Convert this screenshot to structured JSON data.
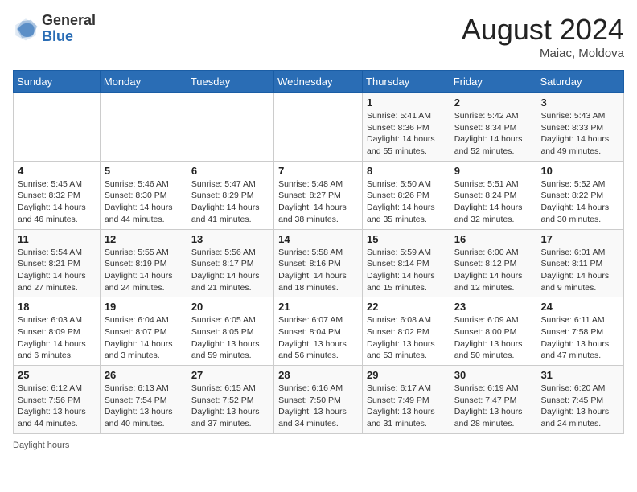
{
  "header": {
    "logo_general": "General",
    "logo_blue": "Blue",
    "month_title": "August 2024",
    "location": "Maiac, Moldova"
  },
  "days_of_week": [
    "Sunday",
    "Monday",
    "Tuesday",
    "Wednesday",
    "Thursday",
    "Friday",
    "Saturday"
  ],
  "weeks": [
    [
      {
        "day": "",
        "info": ""
      },
      {
        "day": "",
        "info": ""
      },
      {
        "day": "",
        "info": ""
      },
      {
        "day": "",
        "info": ""
      },
      {
        "day": "1",
        "info": "Sunrise: 5:41 AM\nSunset: 8:36 PM\nDaylight: 14 hours and 55 minutes."
      },
      {
        "day": "2",
        "info": "Sunrise: 5:42 AM\nSunset: 8:34 PM\nDaylight: 14 hours and 52 minutes."
      },
      {
        "day": "3",
        "info": "Sunrise: 5:43 AM\nSunset: 8:33 PM\nDaylight: 14 hours and 49 minutes."
      }
    ],
    [
      {
        "day": "4",
        "info": "Sunrise: 5:45 AM\nSunset: 8:32 PM\nDaylight: 14 hours and 46 minutes."
      },
      {
        "day": "5",
        "info": "Sunrise: 5:46 AM\nSunset: 8:30 PM\nDaylight: 14 hours and 44 minutes."
      },
      {
        "day": "6",
        "info": "Sunrise: 5:47 AM\nSunset: 8:29 PM\nDaylight: 14 hours and 41 minutes."
      },
      {
        "day": "7",
        "info": "Sunrise: 5:48 AM\nSunset: 8:27 PM\nDaylight: 14 hours and 38 minutes."
      },
      {
        "day": "8",
        "info": "Sunrise: 5:50 AM\nSunset: 8:26 PM\nDaylight: 14 hours and 35 minutes."
      },
      {
        "day": "9",
        "info": "Sunrise: 5:51 AM\nSunset: 8:24 PM\nDaylight: 14 hours and 32 minutes."
      },
      {
        "day": "10",
        "info": "Sunrise: 5:52 AM\nSunset: 8:22 PM\nDaylight: 14 hours and 30 minutes."
      }
    ],
    [
      {
        "day": "11",
        "info": "Sunrise: 5:54 AM\nSunset: 8:21 PM\nDaylight: 14 hours and 27 minutes."
      },
      {
        "day": "12",
        "info": "Sunrise: 5:55 AM\nSunset: 8:19 PM\nDaylight: 14 hours and 24 minutes."
      },
      {
        "day": "13",
        "info": "Sunrise: 5:56 AM\nSunset: 8:17 PM\nDaylight: 14 hours and 21 minutes."
      },
      {
        "day": "14",
        "info": "Sunrise: 5:58 AM\nSunset: 8:16 PM\nDaylight: 14 hours and 18 minutes."
      },
      {
        "day": "15",
        "info": "Sunrise: 5:59 AM\nSunset: 8:14 PM\nDaylight: 14 hours and 15 minutes."
      },
      {
        "day": "16",
        "info": "Sunrise: 6:00 AM\nSunset: 8:12 PM\nDaylight: 14 hours and 12 minutes."
      },
      {
        "day": "17",
        "info": "Sunrise: 6:01 AM\nSunset: 8:11 PM\nDaylight: 14 hours and 9 minutes."
      }
    ],
    [
      {
        "day": "18",
        "info": "Sunrise: 6:03 AM\nSunset: 8:09 PM\nDaylight: 14 hours and 6 minutes."
      },
      {
        "day": "19",
        "info": "Sunrise: 6:04 AM\nSunset: 8:07 PM\nDaylight: 14 hours and 3 minutes."
      },
      {
        "day": "20",
        "info": "Sunrise: 6:05 AM\nSunset: 8:05 PM\nDaylight: 13 hours and 59 minutes."
      },
      {
        "day": "21",
        "info": "Sunrise: 6:07 AM\nSunset: 8:04 PM\nDaylight: 13 hours and 56 minutes."
      },
      {
        "day": "22",
        "info": "Sunrise: 6:08 AM\nSunset: 8:02 PM\nDaylight: 13 hours and 53 minutes."
      },
      {
        "day": "23",
        "info": "Sunrise: 6:09 AM\nSunset: 8:00 PM\nDaylight: 13 hours and 50 minutes."
      },
      {
        "day": "24",
        "info": "Sunrise: 6:11 AM\nSunset: 7:58 PM\nDaylight: 13 hours and 47 minutes."
      }
    ],
    [
      {
        "day": "25",
        "info": "Sunrise: 6:12 AM\nSunset: 7:56 PM\nDaylight: 13 hours and 44 minutes."
      },
      {
        "day": "26",
        "info": "Sunrise: 6:13 AM\nSunset: 7:54 PM\nDaylight: 13 hours and 40 minutes."
      },
      {
        "day": "27",
        "info": "Sunrise: 6:15 AM\nSunset: 7:52 PM\nDaylight: 13 hours and 37 minutes."
      },
      {
        "day": "28",
        "info": "Sunrise: 6:16 AM\nSunset: 7:50 PM\nDaylight: 13 hours and 34 minutes."
      },
      {
        "day": "29",
        "info": "Sunrise: 6:17 AM\nSunset: 7:49 PM\nDaylight: 13 hours and 31 minutes."
      },
      {
        "day": "30",
        "info": "Sunrise: 6:19 AM\nSunset: 7:47 PM\nDaylight: 13 hours and 28 minutes."
      },
      {
        "day": "31",
        "info": "Sunrise: 6:20 AM\nSunset: 7:45 PM\nDaylight: 13 hours and 24 minutes."
      }
    ]
  ],
  "footer": {
    "note": "Daylight hours"
  }
}
